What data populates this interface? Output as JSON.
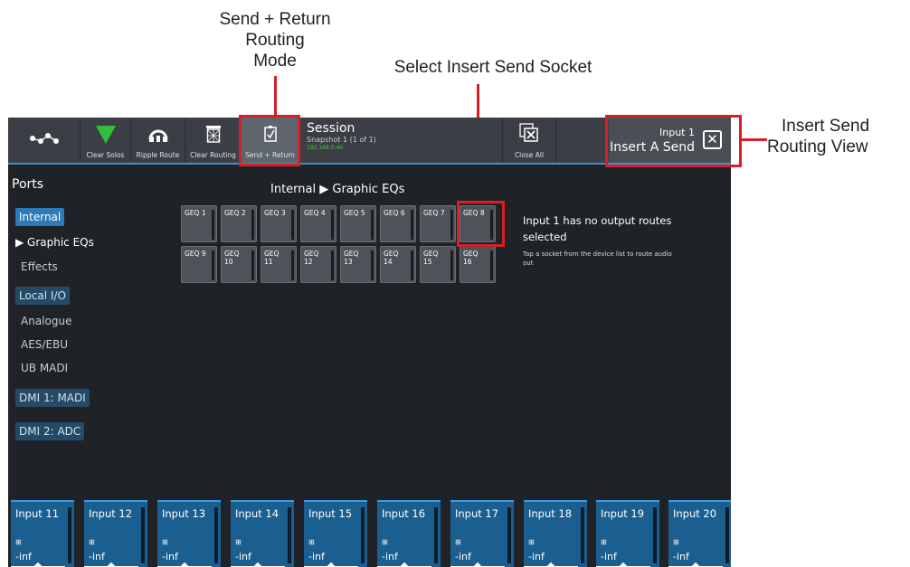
{
  "callouts": {
    "send_return": [
      "Send + Return",
      "Routing",
      "Mode"
    ],
    "select_socket": "Select Insert Send Socket",
    "insert_view": [
      "Insert Send",
      "Routing View"
    ]
  },
  "toolbar": {
    "items": [
      {
        "label": "",
        "icon": "routing-icon"
      },
      {
        "label": "Clear Solos",
        "icon": "green-triangle-icon"
      },
      {
        "label": "Ripple Route",
        "icon": "ripple-route-icon"
      },
      {
        "label": "Clear Routing",
        "icon": "trash-icon"
      },
      {
        "label": "Send + Return",
        "icon": "send-return-icon"
      }
    ],
    "close_all": "Close All"
  },
  "session": {
    "title": "Session",
    "snapshot": "Snapshot 1 (1 of 1)",
    "ip": "192.168.0.40"
  },
  "insert_send": {
    "line1": "Input 1",
    "line2": "Insert A Send"
  },
  "ports": {
    "title": "Ports",
    "items": [
      {
        "label": "Internal",
        "style": "sel"
      },
      {
        "label": "▶ Graphic EQs",
        "style": "cur"
      },
      {
        "label": "Effects",
        "style": "dim"
      },
      {
        "label": "Local I/O",
        "style": "chip"
      },
      {
        "label": "Analogue",
        "style": "dim"
      },
      {
        "label": "AES/EBU",
        "style": "dim"
      },
      {
        "label": "UB MADI",
        "style": "dim"
      },
      {
        "label": "DMI 1: MADI",
        "style": "chip"
      },
      {
        "label": "DMI 2: ADC",
        "style": "chip"
      }
    ]
  },
  "breadcrumb": "Internal ▶ Graphic EQs",
  "geqs": [
    "GEQ 1",
    "GEQ 2",
    "GEQ 3",
    "GEQ 4",
    "GEQ 5",
    "GEQ 6",
    "GEQ 7",
    "GEQ 8",
    "GEQ 9",
    "GEQ 10",
    "GEQ 11",
    "GEQ 12",
    "GEQ 13",
    "GEQ 14",
    "GEQ 15",
    "GEQ 16"
  ],
  "info": {
    "status": "Input 1 has no output routes selected",
    "hint": "Tap a socket from the device list to route audio out"
  },
  "strips": [
    {
      "name": "Input 11",
      "value": "-inf"
    },
    {
      "name": "Input 12",
      "value": "-inf"
    },
    {
      "name": "Input 13",
      "value": "-inf"
    },
    {
      "name": "Input 14",
      "value": "-inf"
    },
    {
      "name": "Input 15",
      "value": "-inf"
    },
    {
      "name": "Input 16",
      "value": "-inf"
    },
    {
      "name": "Input 17",
      "value": "-inf"
    },
    {
      "name": "Input 18",
      "value": "-inf"
    },
    {
      "name": "Input 19",
      "value": "-inf"
    },
    {
      "name": "Input 20",
      "value": "-inf"
    }
  ],
  "colors": {
    "highlight": "#d71f26",
    "accent": "#3c8fc9",
    "strip": "#1b5f90"
  }
}
